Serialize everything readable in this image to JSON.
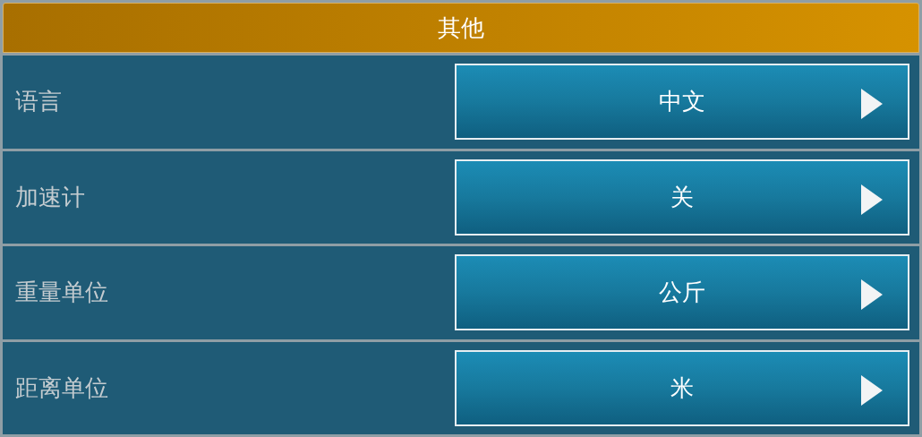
{
  "header": {
    "title": "其他"
  },
  "settings": [
    {
      "label": "语言",
      "value": "中文"
    },
    {
      "label": "加速计",
      "value": "关"
    },
    {
      "label": "重量单位",
      "value": "公斤"
    },
    {
      "label": "距离单位",
      "value": "米"
    }
  ]
}
